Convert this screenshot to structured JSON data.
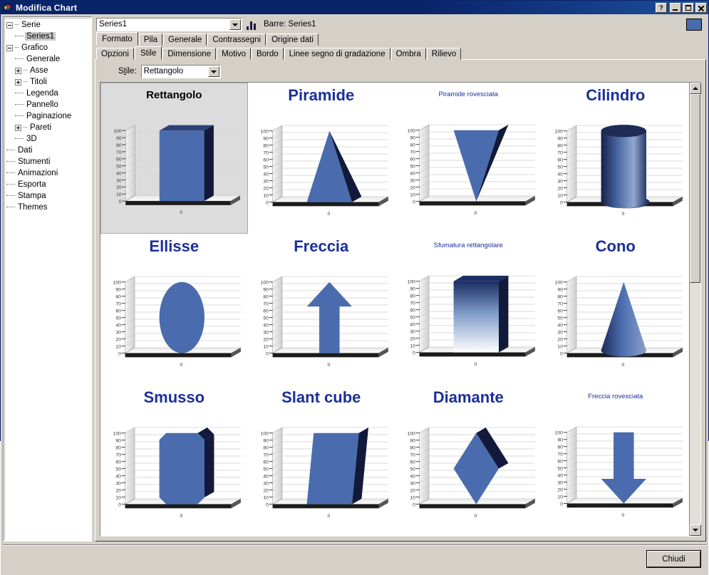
{
  "window": {
    "title": "Modifica Chart",
    "icon": "chart-pie-icon",
    "help_label": "?",
    "minimize_label": "",
    "maximize_label": "",
    "close_label": ""
  },
  "sidebar": {
    "items": [
      {
        "label": "Serie",
        "level": 0,
        "expander": "minus"
      },
      {
        "label": "Series1",
        "level": 1,
        "expander": "none",
        "selected": true
      },
      {
        "label": "Grafico",
        "level": 0,
        "expander": "minus"
      },
      {
        "label": "Generale",
        "level": 1,
        "expander": "none"
      },
      {
        "label": "Asse",
        "level": 1,
        "expander": "plus"
      },
      {
        "label": "Titoli",
        "level": 1,
        "expander": "plus"
      },
      {
        "label": "Legenda",
        "level": 1,
        "expander": "none"
      },
      {
        "label": "Pannello",
        "level": 1,
        "expander": "none"
      },
      {
        "label": "Paginazione",
        "level": 1,
        "expander": "none"
      },
      {
        "label": "Pareti",
        "level": 1,
        "expander": "plus"
      },
      {
        "label": "3D",
        "level": 1,
        "expander": "none"
      },
      {
        "label": "Dati",
        "level": 0,
        "expander": "none"
      },
      {
        "label": "Stumenti",
        "level": 0,
        "expander": "none"
      },
      {
        "label": "Animazioni",
        "level": 0,
        "expander": "none"
      },
      {
        "label": "Esporta",
        "level": 0,
        "expander": "none"
      },
      {
        "label": "Stampa",
        "level": 0,
        "expander": "none"
      },
      {
        "label": "Themes",
        "level": 0,
        "expander": "none"
      }
    ]
  },
  "topbar": {
    "series_combo_value": "Series1",
    "series_combo_icon": "chevron-down-icon",
    "chart_type_icon": "bar-chart-icon",
    "chart_type_label": "Barre: Series1",
    "color_swatch": "#4a6cae"
  },
  "tabs_primary": [
    {
      "label": "Formato",
      "active": true
    },
    {
      "label": "Pila",
      "active": false
    },
    {
      "label": "Generale",
      "active": false
    },
    {
      "label": "Contrassegni",
      "active": false
    },
    {
      "label": "Origine dati",
      "active": false
    }
  ],
  "tabs_secondary": [
    {
      "label": "Opzioni",
      "active": false
    },
    {
      "label": "Stile",
      "active": true
    },
    {
      "label": "Dimensione",
      "active": false
    },
    {
      "label": "Motivo",
      "active": false
    },
    {
      "label": "Bordo",
      "active": false
    },
    {
      "label": "Linee segno di gradazione",
      "active": false
    },
    {
      "label": "Ombra",
      "active": false
    },
    {
      "label": "Rilievo",
      "active": false
    }
  ],
  "style_field": {
    "label_pre": "S",
    "label_accel": "t",
    "label_post": "ile:",
    "value": "Rettangolo",
    "arrow_icon": "chevron-down-icon"
  },
  "gallery": {
    "items": [
      {
        "label": "Rettangolo",
        "shape": "rectangle",
        "size": "mid",
        "selected": true
      },
      {
        "label": "Piramide",
        "shape": "pyramid",
        "size": "big",
        "selected": false
      },
      {
        "label": "Piramide rovesciata",
        "shape": "inverted-pyramid",
        "size": "small",
        "selected": false
      },
      {
        "label": "Cilindro",
        "shape": "cylinder",
        "size": "big",
        "selected": false
      },
      {
        "label": "Ellisse",
        "shape": "ellipse",
        "size": "big",
        "selected": false
      },
      {
        "label": "Freccia",
        "shape": "arrow",
        "size": "big",
        "selected": false
      },
      {
        "label": "Sfumatura rettangolare",
        "shape": "gradient-rect",
        "size": "small",
        "selected": false
      },
      {
        "label": "Cono",
        "shape": "cone",
        "size": "big",
        "selected": false
      },
      {
        "label": "Smusso",
        "shape": "bevel",
        "size": "big",
        "selected": false
      },
      {
        "label": "Slant cube",
        "shape": "slant-cube",
        "size": "big",
        "selected": false
      },
      {
        "label": "Diamante",
        "shape": "diamond",
        "size": "big",
        "selected": false
      },
      {
        "label": "Freccia rovesciata",
        "shape": "inverted-arrow",
        "size": "small",
        "selected": false
      }
    ],
    "axis_ticks": [
      "100",
      "90",
      "80",
      "70",
      "60",
      "50",
      "40",
      "30",
      "20",
      "10",
      "0"
    ],
    "x_tick": "0",
    "bar_color": "#4a6cae",
    "bar_side_color": "#121a3c",
    "scroll_up_icon": "triangle-up-icon",
    "scroll_down_icon": "triangle-down-icon"
  },
  "chart_data": {
    "type": "bar",
    "title": "Rettangolo",
    "categories": [
      "0"
    ],
    "values": [
      100
    ],
    "xlabel": "",
    "ylabel": "",
    "ylim": [
      0,
      100
    ],
    "yticks": [
      0,
      10,
      20,
      30,
      40,
      50,
      60,
      70,
      80,
      90,
      100
    ],
    "grid": true,
    "legend": "none",
    "series": [
      {
        "name": "Series1",
        "values": [
          100
        ],
        "color": "#4a6cae"
      }
    ]
  },
  "footer": {
    "close_button": "Chiudi"
  }
}
